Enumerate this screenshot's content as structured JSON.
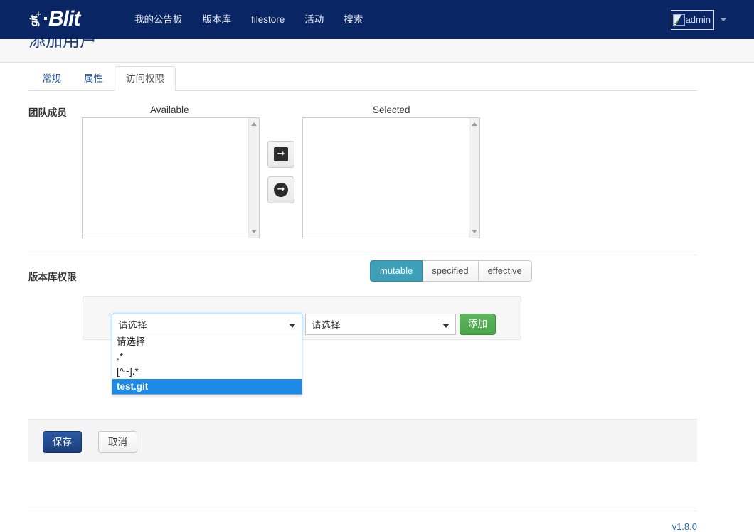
{
  "navbar": {
    "brand_mark": "git",
    "brand_plus": "+",
    "brand_name": "Blit",
    "links": [
      {
        "label": "我的公告板"
      },
      {
        "label": "版本库"
      },
      {
        "label": "filestore"
      },
      {
        "label": "活动"
      },
      {
        "label": "搜索"
      }
    ],
    "user": {
      "name": "admin",
      "avatar_icon": "broken-image-icon",
      "caret_icon": "caret-down-icon"
    }
  },
  "page": {
    "title": "添加用户"
  },
  "tabs": [
    {
      "label": "常规",
      "active": false
    },
    {
      "label": "属性",
      "active": false
    },
    {
      "label": "访问权限",
      "active": true
    }
  ],
  "team": {
    "label": "团队成员",
    "available_header": "Available",
    "selected_header": "Selected",
    "available_items": [],
    "selected_items": [],
    "add_button_glyph": "➜",
    "remove_button_glyph": "➜"
  },
  "repo_permissions": {
    "label": "版本库权限",
    "modes": [
      {
        "label": "mutable",
        "active": true
      },
      {
        "label": "specified",
        "active": false
      },
      {
        "label": "effective",
        "active": false
      }
    ],
    "repo_select": {
      "value": "请选择",
      "open": true,
      "options": [
        {
          "label": "请选择",
          "selected": false
        },
        {
          "label": ".*",
          "selected": false
        },
        {
          "label": "[^~].*",
          "selected": false
        },
        {
          "label": "test.git",
          "selected": true
        }
      ]
    },
    "permission_select": {
      "value": "请选择",
      "open": false
    },
    "add_label": "添加"
  },
  "form_actions": {
    "save_label": "保存",
    "cancel_label": "取消"
  },
  "footer": {
    "version": "v1.8.0"
  },
  "colors": {
    "navbar_bg": "#0a2563",
    "accent_teal": "#3d9fb8",
    "accent_green": "#49a449",
    "accent_blue": "#1b3e79",
    "option_highlight": "#1e8ae8",
    "link": "#2a6ab5"
  }
}
